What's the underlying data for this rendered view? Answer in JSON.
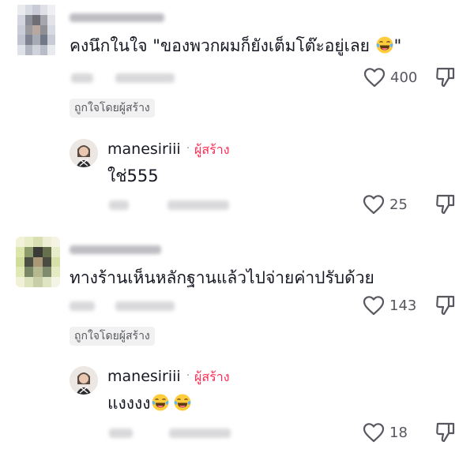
{
  "comments": [
    {
      "text": "คงนึกในใจ \"ของพวกผมก็ยังเต็มโต๊ะอยู่เลย ",
      "text_end": "\"",
      "likes": "400",
      "creator_liked": "ถูกใจโดยผู้สร้าง",
      "reply": {
        "username": "manesiriii",
        "separator": "·",
        "creator_tag": "ผู้สร้าง",
        "text": "ใช่555",
        "likes": "25"
      }
    },
    {
      "text": "ทางร้านเห็นหลักฐานแล้วไปจ่ายค่าปรับด้วย",
      "likes": "143",
      "creator_liked": "ถูกใจโดยผู้สร้าง",
      "reply": {
        "username": "manesiriii",
        "separator": "·",
        "creator_tag": "ผู้สร้าง",
        "text": "แงงงง",
        "likes": "18"
      }
    }
  ],
  "icons": {
    "like": "heart-outline-icon",
    "dislike": "thumbs-down-outline-icon",
    "emoji": "tears-of-joy-emoji"
  },
  "colors": {
    "creator_tag": "#fe2c55",
    "text": "#161823",
    "muted": "#57585f",
    "badge_bg": "#f1f1f2"
  }
}
